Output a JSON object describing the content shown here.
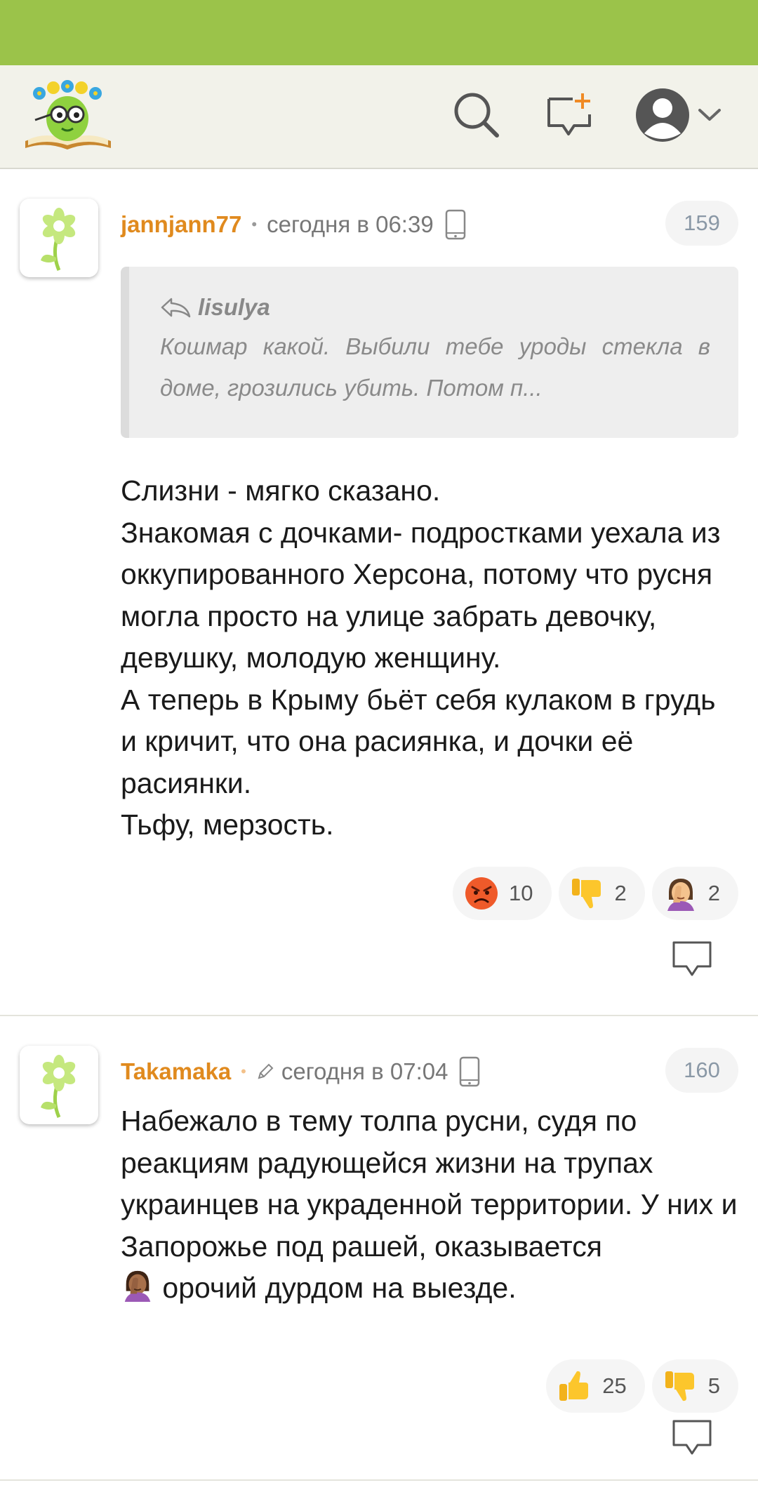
{
  "header": {
    "logo": "site-logo",
    "icons": [
      "search-icon",
      "new-message-icon",
      "user-avatar-icon",
      "chevron-down-icon"
    ]
  },
  "colors": {
    "status_bar": "#9bc34a",
    "header_bg": "#f2f2ea",
    "author": "#e08a1e"
  },
  "comments": [
    {
      "author": "jannjann77",
      "separator": "•",
      "time": "сегодня в 06:39",
      "number": "159",
      "quote": {
        "author": "lisulya",
        "text": "Кошмар какой. Выбили тебе уроды стекла в доме, грозились убить. Потом п..."
      },
      "text": "Слизни - мягко сказано.\nЗнакомая с дочками- подростками уехала из оккупированного Херсона, потому что русня могла просто на улице забрать девочку, девушку, молодую женщину.\nА теперь в Крыму бьёт себя кулаком в грудь и кричит, что она расиянка, и дочки её расиянки.\nТьфу, мерзость.",
      "reactions": [
        {
          "icon": "angry-face-icon",
          "count": "10"
        },
        {
          "icon": "thumbs-down-icon",
          "count": "2"
        },
        {
          "icon": "facepalm-icon",
          "count": "2"
        }
      ]
    },
    {
      "author": "Takamaka",
      "separator": "•",
      "time": "сегодня в 07:04",
      "number": "160",
      "edited": true,
      "text": "Набежало в тему толпа русни, судя по реакциям радующейся жизни на трупах украинцев на украденной территории. У них и Запорожье под рашей, оказывается",
      "text_tail": " орочий дурдом на выезде.",
      "inline_emoji": "facepalm-icon",
      "reactions": [
        {
          "icon": "thumbs-up-icon",
          "count": "25"
        },
        {
          "icon": "thumbs-down-icon",
          "count": "5"
        }
      ]
    }
  ]
}
